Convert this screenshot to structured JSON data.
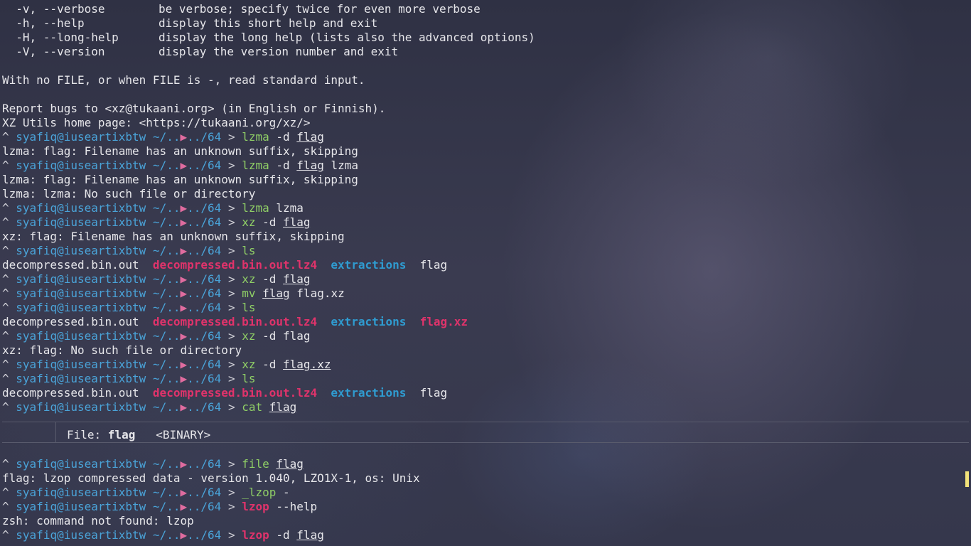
{
  "terminal": {
    "options": [
      {
        "flag": "  -v, --verbose",
        "desc": "be verbose; specify twice for even more verbose"
      },
      {
        "flag": "  -h, --help",
        "desc": "display this short help and exit"
      },
      {
        "flag": "  -H, --long-help",
        "desc": "display the long help (lists also the advanced options)"
      },
      {
        "flag": "  -V, --version",
        "desc": "display the version number and exit"
      }
    ],
    "stdin_note": "With no FILE, or when FILE is -, read standard input.",
    "bugs": "Report bugs to <xz@tukaani.org> (in English or Finnish).",
    "homepage": "XZ Utils home page: <https://tukaani.org/xz/>",
    "prompt": {
      "caret": "^",
      "user_host": "syafiq@iuseartixbtw",
      "path_prefix": "~/",
      "path_dots": "..",
      "dir_icon": "▶",
      "path_suffix": "../64",
      "arrow": ">"
    },
    "lines": {
      "c1_cmd": "lzma",
      "c1_args": "-d",
      "c1_file": "flag",
      "o1": "lzma: flag: Filename has an unknown suffix, skipping",
      "c2_cmd": "lzma",
      "c2_args": "-d",
      "c2_file": "flag",
      "c2_tail": "lzma",
      "o2a": "lzma: flag: Filename has an unknown suffix, skipping",
      "o2b": "lzma: lzma: No such file or directory",
      "c3_cmd": "lzma",
      "c3_tail": "lzma",
      "c4_cmd": "xz",
      "c4_args": "-d",
      "c4_file": "flag",
      "o4": "xz: flag: Filename has an unknown suffix, skipping",
      "c5_cmd": "ls",
      "ls1": [
        "decompressed.bin.out",
        "decompressed.bin.out.lz4",
        "extractions",
        "flag"
      ],
      "c6_cmd": "xz",
      "c6_args": "-d",
      "c6_file": "flag",
      "c7_cmd": "mv",
      "c7_file": "flag",
      "c7_tail": "flag.xz",
      "c8_cmd": "ls",
      "ls2": [
        "decompressed.bin.out",
        "decompressed.bin.out.lz4",
        "extractions",
        "flag.xz"
      ],
      "c9_cmd": "xz",
      "c9_args": "-d",
      "c9_tail": "flag",
      "o9": "xz: flag: No such file or directory",
      "c10_cmd": "xz",
      "c10_args": "-d",
      "c10_file": "flag.xz",
      "c11_cmd": "ls",
      "ls3": [
        "decompressed.bin.out",
        "decompressed.bin.out.lz4",
        "extractions",
        "flag"
      ],
      "c12_cmd": "cat",
      "c12_file": "flag",
      "bat_file_label": "File: ",
      "bat_file_name": "flag",
      "bat_binary": "<BINARY>",
      "c13_cmd": "file",
      "c13_file": "flag",
      "o13": "flag: lzop compressed data - version 1.040, LZO1X-1, os: Unix",
      "c14_cmd": "_lzop",
      "c14_tail": "-",
      "c15_cmd": "lzop",
      "c15_tail": "--help",
      "o15": "zsh: command not found: lzop",
      "c16_cmd": "lzop",
      "c16_args": "-d",
      "c16_file": "flag"
    }
  },
  "colors": {
    "prompt_blue": "#4aa3d8",
    "cmd_green": "#8fce66",
    "cmd_error_red": "#e0336b",
    "ls_archive_red": "#e0336b",
    "ls_dir_blue": "#2f9bd0",
    "cursor_yellow": "#f2e27a"
  }
}
